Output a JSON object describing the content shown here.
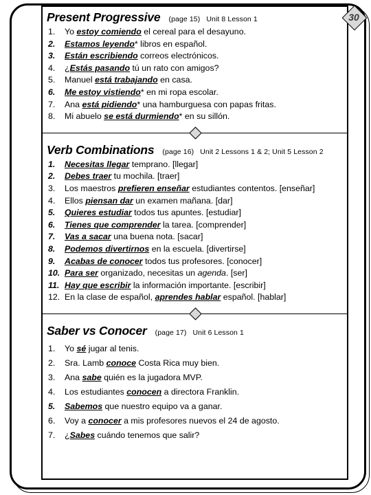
{
  "document": {
    "page_badge": "30"
  },
  "sections": [
    {
      "title": "Present Progressive",
      "meta_page": "(page 15)",
      "meta_unit": "Unit  8 Lesson 1",
      "items": [
        {
          "num": "1.",
          "bold_num": false,
          "pre": "Yo ",
          "vp": "estoy comiendo",
          "post": " el cereal para el desayuno."
        },
        {
          "num": "2.",
          "bold_num": true,
          "pre": "",
          "vp": "Estamos leyendo",
          "post": "* libros en español."
        },
        {
          "num": "3.",
          "bold_num": true,
          "pre": "",
          "vp": "Están escribiendo",
          "post": " correos electrónicos."
        },
        {
          "num": "4.",
          "bold_num": false,
          "pre": "¿",
          "vp": "Estás pasando",
          "post": " tú un rato con amigos?"
        },
        {
          "num": "5.",
          "bold_num": false,
          "pre": "Manuel ",
          "vp": "está trabajando",
          "post": " en casa."
        },
        {
          "num": "6.",
          "bold_num": true,
          "pre": "",
          "vp": "Me estoy vistiendo",
          "post": "* en mi ropa escolar."
        },
        {
          "num": "7.",
          "bold_num": false,
          "pre": "Ana ",
          "vp": "está pidiendo",
          "post": "* una hamburguesa con papas fritas."
        },
        {
          "num": "8.",
          "bold_num": false,
          "pre": "Mi abuelo ",
          "vp": "se está durmiendo",
          "post": "* en su sillón."
        }
      ]
    },
    {
      "title": "Verb Combinations",
      "meta_page": "(page 16)",
      "meta_unit": "Unit 2  Lessons 1 & 2; Unit 5 Lesson 2",
      "items": [
        {
          "num": "1.",
          "bold_num": true,
          "pre": "",
          "vp": "Necesitas llegar",
          "post": " temprano.    [llegar]"
        },
        {
          "num": "2.",
          "bold_num": true,
          "pre": "",
          "vp": "Debes traer",
          "post": " tu mochila.       [traer]"
        },
        {
          "num": "3.",
          "bold_num": false,
          "pre": "Los maestros ",
          "vp": "prefieren enseñar",
          "post": " estudiantes contentos. [enseñar]"
        },
        {
          "num": "4.",
          "bold_num": false,
          "pre": "Ellos ",
          "vp": "piensan dar",
          "post": " un examen mañana.    [dar]"
        },
        {
          "num": "5.",
          "bold_num": true,
          "pre": "",
          "vp": "Quieres estudiar",
          "post": " todos tus apuntes.  [estudiar]"
        },
        {
          "num": "6.",
          "bold_num": true,
          "pre": "",
          "vp": "Tienes que comprender",
          "post": " la tarea. [comprender]"
        },
        {
          "num": "7.",
          "bold_num": true,
          "pre": "",
          "vp": "Vas a sacar",
          "post": " una buena nota. [sacar]"
        },
        {
          "num": "8.",
          "bold_num": true,
          "pre": "",
          "vp": "Podemos divertirnos",
          "post": " en la escuela.  [divertirse]"
        },
        {
          "num": "9.",
          "bold_num": true,
          "pre": "",
          "vp": "Acabas de conocer",
          "post": " todos tus profesores.  [conocer]"
        },
        {
          "num": "10.",
          "bold_num": true,
          "pre": "",
          "vp": "Para ser",
          "post": " organizado, necesitas un ",
          "post_italic": "agenda",
          "tail": ".  [ser]"
        },
        {
          "num": "11.",
          "bold_num": true,
          "pre": "",
          "vp": "Hay que escribir",
          "post": " la información importante.  [escribir]"
        },
        {
          "num": "12.",
          "bold_num": false,
          "pre": "En la clase de español, ",
          "vp": "aprendes hablar",
          "post": " español. [hablar]"
        }
      ]
    },
    {
      "title": "Saber vs Conocer",
      "meta_page": "(page 17)",
      "meta_unit": "Unit  6  Lesson  1",
      "items": [
        {
          "num": "1.",
          "bold_num": false,
          "pre": "Yo ",
          "vp": "sé",
          "post": " jugar al tenis."
        },
        {
          "num": "2.",
          "bold_num": false,
          "pre": "Sra. Lamb ",
          "vp": "conoce",
          "post": " Costa Rica muy bien."
        },
        {
          "num": "3.",
          "bold_num": false,
          "pre": "Ana ",
          "vp": "sabe",
          "post": " quién es la jugadora MVP."
        },
        {
          "num": "4.",
          "bold_num": false,
          "pre": "Los estudiantes ",
          "vp": "conocen",
          "post": " a directora Franklin."
        },
        {
          "num": "5.",
          "bold_num": true,
          "pre": "",
          "vp": "Sabemos",
          "post": " que nuestro equipo va a ganar."
        },
        {
          "num": "6.",
          "bold_num": false,
          "pre": "Voy a ",
          "vp": "conocer",
          "post": " a mis profesores nuevos el 24 de agosto."
        },
        {
          "num": "7.",
          "bold_num": false,
          "pre": "¿",
          "vp": "Sabes",
          "post": " cuándo tenemos que salir?"
        }
      ]
    }
  ]
}
